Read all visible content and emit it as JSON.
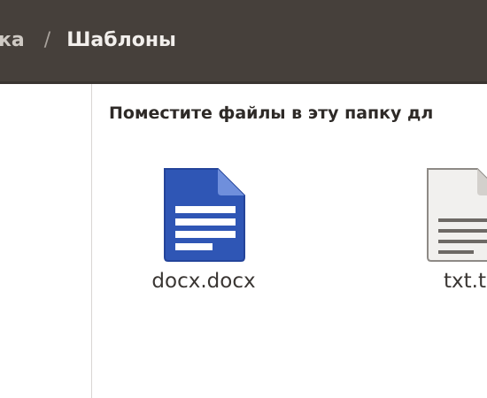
{
  "header": {
    "breadcrumb_prev": "ка",
    "separator": "/",
    "breadcrumb_current": "Шаблоны"
  },
  "main": {
    "hint": "Поместите файлы в эту папку дл",
    "files": [
      {
        "label": "docx.docx",
        "icon": "document-icon"
      },
      {
        "label": "txt.t",
        "icon": "text-file-icon"
      }
    ]
  },
  "colors": {
    "header_bg": "#46403b",
    "docx_blue": "#2f56b5"
  }
}
